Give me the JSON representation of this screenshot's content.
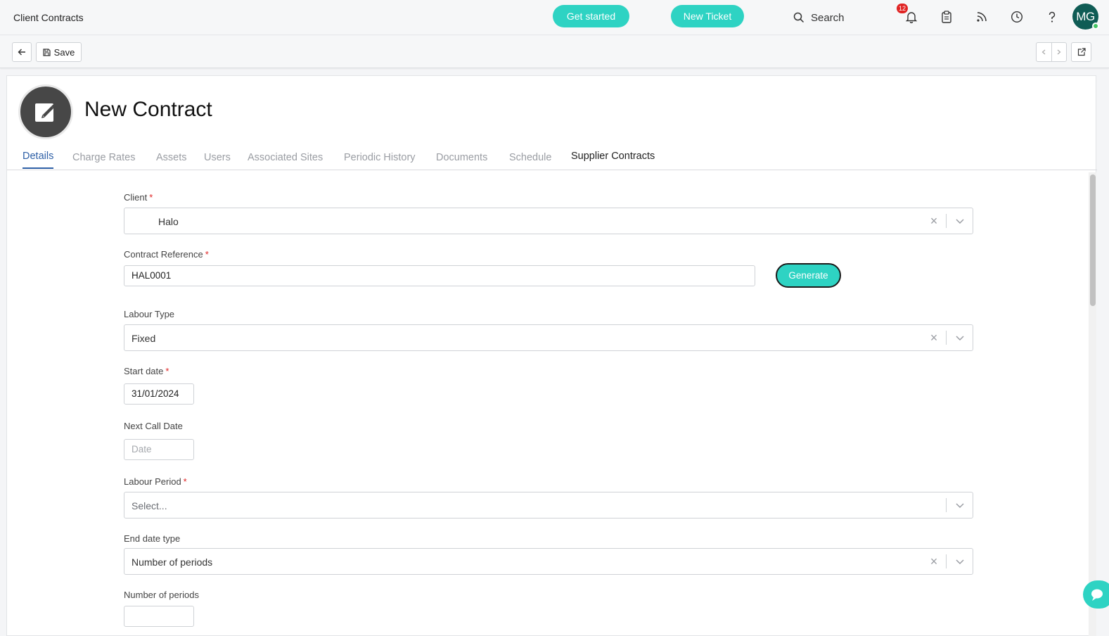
{
  "app": {
    "title": "Client Contracts",
    "get_started": "Get started",
    "new_ticket": "New Ticket",
    "search_label": "Search",
    "notification_count": "12",
    "avatar_initials": "MG"
  },
  "toolbar": {
    "save_label": "Save"
  },
  "page": {
    "title": "New Contract"
  },
  "tabs": [
    {
      "label": "Details",
      "active": true
    },
    {
      "label": "Charge Rates"
    },
    {
      "label": "Assets"
    },
    {
      "label": "Users"
    },
    {
      "label": "Associated Sites"
    },
    {
      "label": "Periodic History"
    },
    {
      "label": "Documents"
    },
    {
      "label": "Schedule"
    },
    {
      "label": "Supplier Contracts"
    }
  ],
  "form": {
    "client": {
      "label": "Client",
      "value": "Halo"
    },
    "contract_reference": {
      "label": "Contract Reference",
      "value": "HAL0001",
      "generate_label": "Generate"
    },
    "labour_type": {
      "label": "Labour Type",
      "value": "Fixed"
    },
    "start_date": {
      "label": "Start date",
      "value": "31/01/2024"
    },
    "next_call_date": {
      "label": "Next Call Date",
      "placeholder": "Date"
    },
    "labour_period": {
      "label": "Labour Period",
      "placeholder": "Select..."
    },
    "end_date_type": {
      "label": "End date type",
      "value": "Number of periods"
    },
    "number_of_periods": {
      "label": "Number of periods",
      "value": ""
    }
  },
  "colors": {
    "accent": "#2ed3c3",
    "active_tab": "#2d5fa6",
    "required": "#e02424",
    "avatar_bg": "#0f5c55"
  }
}
